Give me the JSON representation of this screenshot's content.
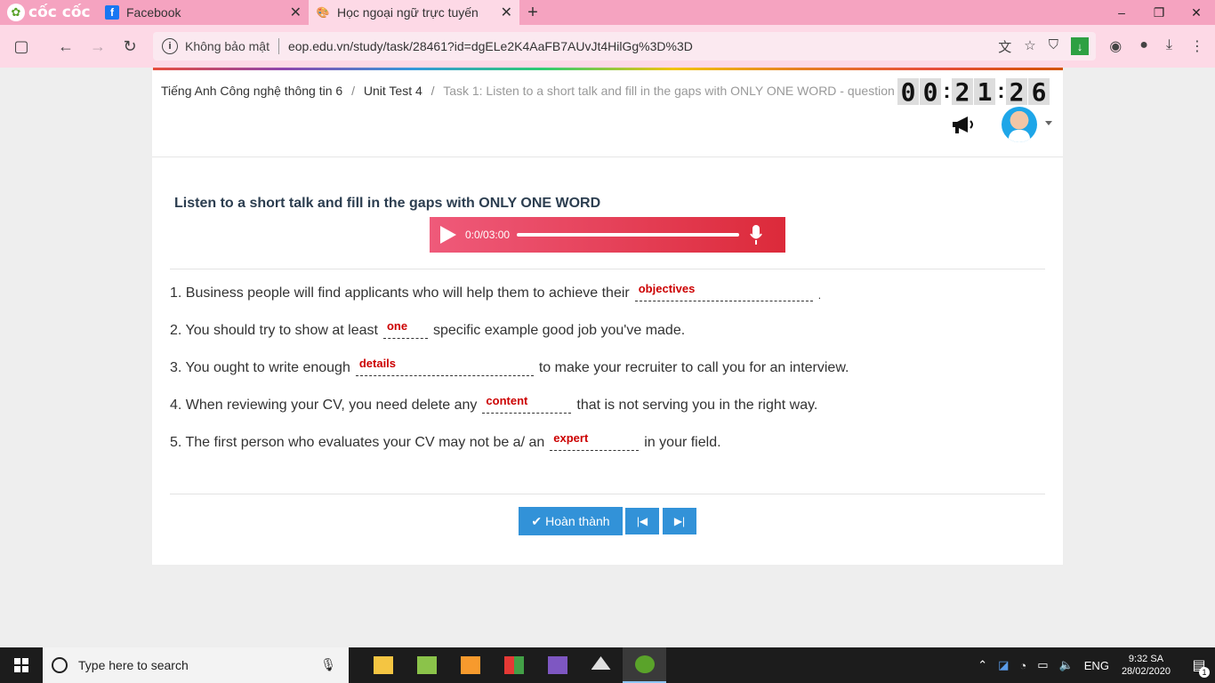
{
  "browser": {
    "brand": "cốc cốc",
    "tabs": [
      {
        "title": "Facebook",
        "icon": "facebook-icon"
      },
      {
        "title": "Học ngoại ngữ trực tuyến",
        "icon": "site-icon"
      }
    ],
    "address": {
      "security_label": "Không bảo mật",
      "url": "eop.edu.vn/study/task/28461?id=dgELe2K4AaFB7AUvJt4HilGg%3D%3D"
    }
  },
  "breadcrumb": {
    "items": [
      "Tiếng Anh Công nghệ thông tin 6",
      "Unit Test 4"
    ],
    "current": "Task 1: Listen to a short talk and fill in the gaps with ONLY ONE WORD - question",
    "separator": "/"
  },
  "timer": {
    "hours": "00",
    "minutes": "21",
    "seconds": "26"
  },
  "task": {
    "title": "Listen to a short talk and fill in the gaps with ONLY ONE WORD",
    "audio_time": "0:0/03:00"
  },
  "questions": [
    {
      "before": "1. Business people will find applicants who will help them to achieve their",
      "answer": "objectives",
      "after": "."
    },
    {
      "before": "2. You should try to show at least",
      "answer": "one",
      "after": "specific example good job you've made."
    },
    {
      "before": "3. You ought to write enough",
      "answer": "details",
      "after": "to make your recruiter to call you for an interview."
    },
    {
      "before": "4. When reviewing your CV, you need delete any",
      "answer": "content",
      "after": "that is not serving you in the right way."
    },
    {
      "before": "5. The first person who evaluates your CV may not be a/ an",
      "answer": "expert",
      "after": "in your field."
    }
  ],
  "buttons": {
    "finish": "Hoàn thành"
  },
  "taskbar": {
    "search_placeholder": "Type here to search",
    "language": "ENG",
    "time": "9:32 SA",
    "date": "28/02/2020",
    "notification_count": "1"
  },
  "colors": {
    "accent": "#3292d8",
    "answer": "#cc0000",
    "audio": "#dc2a3a",
    "chrome": "#f5a3c0"
  }
}
